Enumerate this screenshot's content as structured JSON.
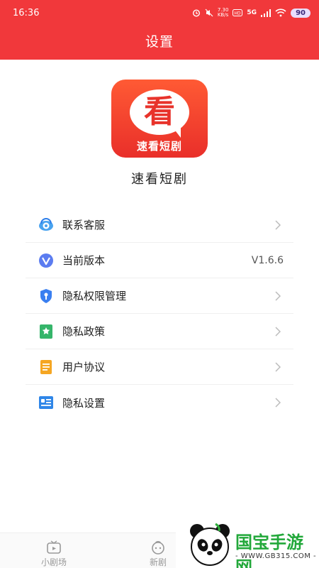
{
  "status_bar": {
    "time": "16:36",
    "net_speed": "7.30\nKB/s",
    "network": "5G",
    "battery": "90"
  },
  "header": {
    "title": "设置"
  },
  "app": {
    "logo_glyph": "看",
    "logo_text": "速看短剧",
    "name": "速看短剧"
  },
  "menu": {
    "items": [
      {
        "label": "联系客服",
        "icon": "customer-service-icon",
        "value": ""
      },
      {
        "label": "当前版本",
        "icon": "version-icon",
        "value": "V1.6.6"
      },
      {
        "label": "隐私权限管理",
        "icon": "privacy-permission-icon",
        "value": ""
      },
      {
        "label": "隐私政策",
        "icon": "privacy-policy-icon",
        "value": ""
      },
      {
        "label": "用户协议",
        "icon": "user-agreement-icon",
        "value": ""
      },
      {
        "label": "隐私设置",
        "icon": "privacy-settings-icon",
        "value": ""
      }
    ]
  },
  "bottom_nav": {
    "items": [
      {
        "label": "小剧场",
        "icon": "tv-icon"
      },
      {
        "label": "新剧",
        "icon": "new-drama-icon"
      }
    ]
  },
  "watermark": {
    "title": "国宝手游网",
    "url": "- WWW.GB315.COM -"
  },
  "colors": {
    "header_red": "#f1383b",
    "logo_red": "#e92f2a",
    "watermark_green": "#22a83a",
    "icon_blue": "#2b7de9"
  }
}
